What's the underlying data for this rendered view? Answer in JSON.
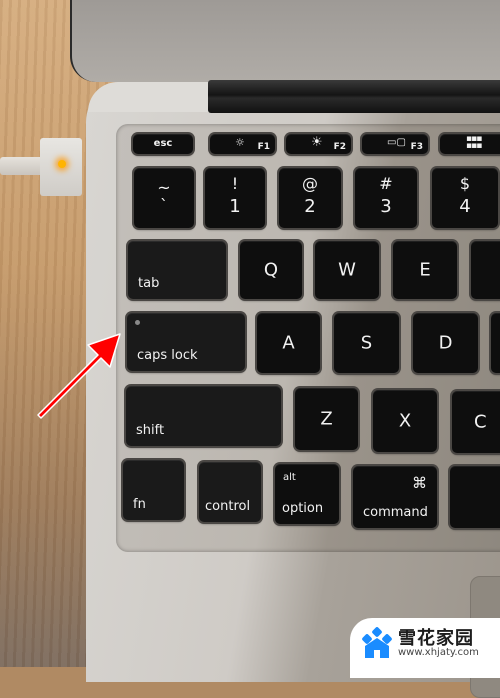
{
  "scene": {
    "description": "Close-up photo of a laptop keyboard with a red arrow pointing at the caps lock key",
    "annotation": {
      "type": "arrow",
      "color": "#ff0000",
      "target": "caps lock key"
    },
    "charger_led_color": "#ffb400"
  },
  "keyboard": {
    "function_row": [
      {
        "main": "esc"
      },
      {
        "icon": "brightness-down-icon",
        "fn": "F1"
      },
      {
        "icon": "brightness-up-icon",
        "fn": "F2"
      },
      {
        "icon": "mission-control-icon",
        "fn": "F3"
      },
      {
        "icon": "launchpad-icon",
        "fn": ""
      }
    ],
    "number_row": [
      {
        "top": "~",
        "bottom": "`"
      },
      {
        "top": "!",
        "bottom": "1"
      },
      {
        "top": "@",
        "bottom": "2"
      },
      {
        "top": "#",
        "bottom": "3"
      },
      {
        "top": "$",
        "bottom": "4"
      }
    ],
    "qwerty_row": [
      "tab",
      "Q",
      "W",
      "E"
    ],
    "home_row": [
      "caps lock",
      "A",
      "S",
      "D"
    ],
    "shift_row": [
      "shift",
      "Z",
      "X",
      "C"
    ],
    "bottom_row": [
      {
        "main": "fn"
      },
      {
        "main": "control"
      },
      {
        "top": "alt",
        "main": "option"
      },
      {
        "top": "⌘",
        "main": "command"
      }
    ]
  },
  "watermark": {
    "brand": "雪花家园",
    "url": "www.xhjaty.com",
    "color": "#1a8cff"
  }
}
